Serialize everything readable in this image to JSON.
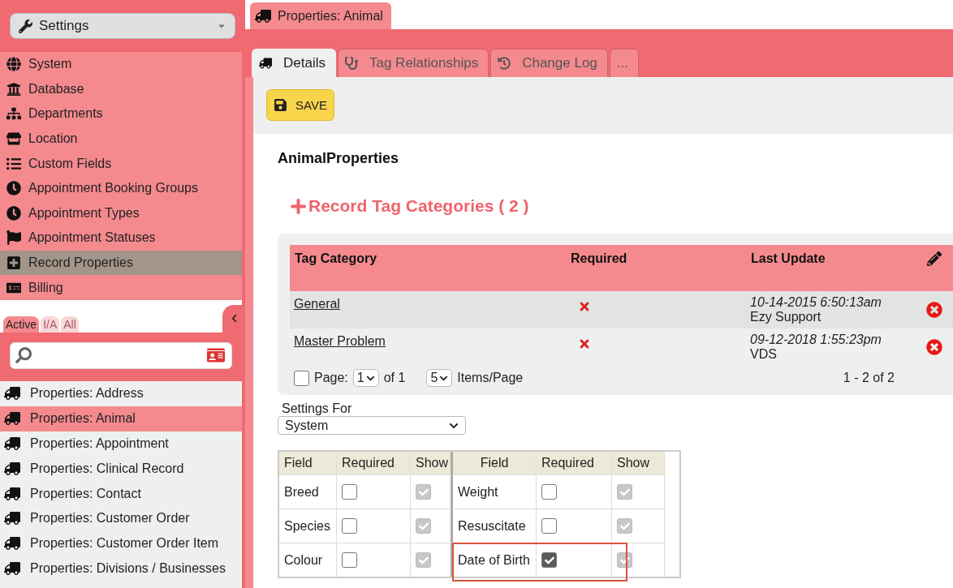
{
  "settings_dropdown": {
    "label": "Settings"
  },
  "menu": [
    {
      "label": "System",
      "selected": false
    },
    {
      "label": "Database",
      "selected": false
    },
    {
      "label": "Departments",
      "selected": false
    },
    {
      "label": "Location",
      "selected": false
    },
    {
      "label": "Custom Fields",
      "selected": false
    },
    {
      "label": "Appointment Booking Groups",
      "selected": false
    },
    {
      "label": "Appointment Types",
      "selected": false
    },
    {
      "label": "Appointment Statuses",
      "selected": false
    },
    {
      "label": "Record Properties",
      "selected": true
    },
    {
      "label": "Billing",
      "selected": false
    }
  ],
  "filter_tabs": [
    {
      "label": "Active",
      "selected": true
    },
    {
      "label": "I/A",
      "selected": false
    },
    {
      "label": "All",
      "selected": false
    }
  ],
  "record_list": [
    {
      "label": "Properties: Address",
      "selected": false
    },
    {
      "label": "Properties: Animal",
      "selected": true
    },
    {
      "label": "Properties: Appointment",
      "selected": false
    },
    {
      "label": "Properties: Clinical Record",
      "selected": false
    },
    {
      "label": "Properties: Contact",
      "selected": false
    },
    {
      "label": "Properties: Customer Order",
      "selected": false
    },
    {
      "label": "Properties: Customer Order Item",
      "selected": false
    },
    {
      "label": "Properties: Divisions / Businesses",
      "selected": false
    }
  ],
  "document_tab": {
    "label": "Properties: Animal"
  },
  "tabs": [
    {
      "label": "Details",
      "selected": true
    },
    {
      "label": "Tag Relationships",
      "selected": false
    },
    {
      "label": "Change Log",
      "selected": false
    },
    {
      "label": "...",
      "selected": false
    }
  ],
  "save_button": "SAVE",
  "heading": "AnimalProperties",
  "section_title": "Record Tag Categories ( 2 )",
  "tag_table": {
    "columns": [
      "Tag Category",
      "Required",
      "Last Update"
    ],
    "rows": [
      {
        "category": "General",
        "required": false,
        "date": "10-14-2015 6:50:13am",
        "user": "Ezy Support"
      },
      {
        "category": "Master Problem",
        "required": false,
        "date": "09-12-2018 1:55:23pm",
        "user": "VDS"
      }
    ],
    "pager": {
      "checked": false,
      "page_label": "Page:",
      "page": "1",
      "of": "of 1",
      "per_page": "5",
      "per_page_label": "Items/Page",
      "summary": "1 - 2 of 2"
    }
  },
  "settings_for": {
    "label": "Settings For",
    "value": "System"
  },
  "fields_table": {
    "columns": [
      "Field",
      "Required",
      "Show",
      "Field",
      "Required",
      "Show"
    ],
    "rows": [
      [
        {
          "field": "Breed",
          "required": false,
          "required_disabled": false,
          "show": true
        },
        {
          "field": "Weight",
          "required": false,
          "required_disabled": false,
          "show": true
        }
      ],
      [
        {
          "field": "Species",
          "required": false,
          "required_disabled": false,
          "show": true
        },
        {
          "field": "Resuscitate",
          "required": false,
          "required_disabled": false,
          "show": true
        }
      ],
      [
        {
          "field": "Colour",
          "required": false,
          "required_disabled": false,
          "show": true
        },
        {
          "field": "Date of Birth",
          "required": true,
          "required_disabled": false,
          "show": true,
          "highlighted": true
        }
      ]
    ]
  }
}
